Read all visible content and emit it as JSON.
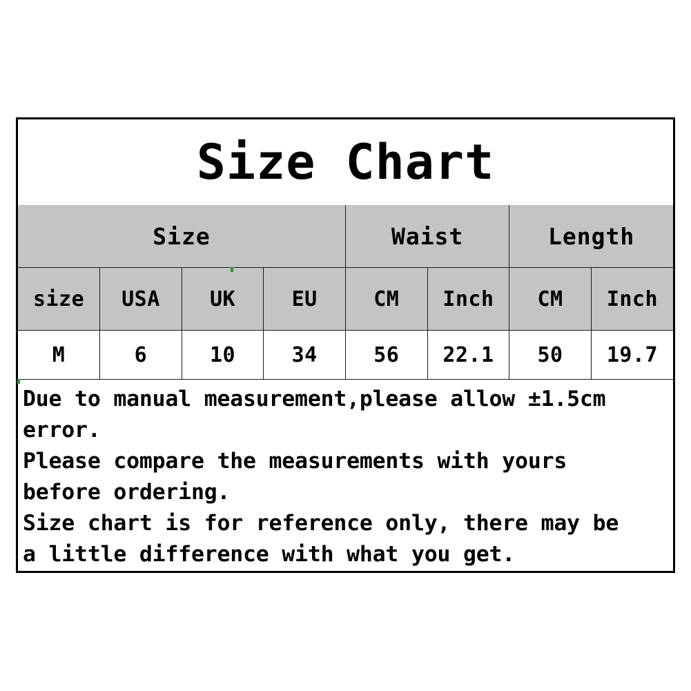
{
  "title": "Size Chart",
  "colors": {
    "header_bg": "#c4c4c4",
    "body_bg": "#ffffff",
    "border": "#000000",
    "text": "#000000"
  },
  "chart_data": {
    "type": "table",
    "title": "Size Chart",
    "group_headers": [
      {
        "label": "Size",
        "span": 4
      },
      {
        "label": "Waist",
        "span": 2
      },
      {
        "label": "Length",
        "span": 2
      }
    ],
    "columns": [
      "size",
      "USA",
      "UK",
      "EU",
      "CM",
      "Inch",
      "CM",
      "Inch"
    ],
    "rows": [
      [
        "M",
        "6",
        "10",
        "34",
        "56",
        "22.1",
        "50",
        "19.7"
      ]
    ]
  },
  "notes": {
    "lines": [
      "Due to manual measurement,please allow ±1.5cm",
      "error.",
      "Please compare the measurements with yours",
      "before ordering.",
      "Size chart is for reference only, there may be",
      "a little difference with what you get."
    ]
  }
}
